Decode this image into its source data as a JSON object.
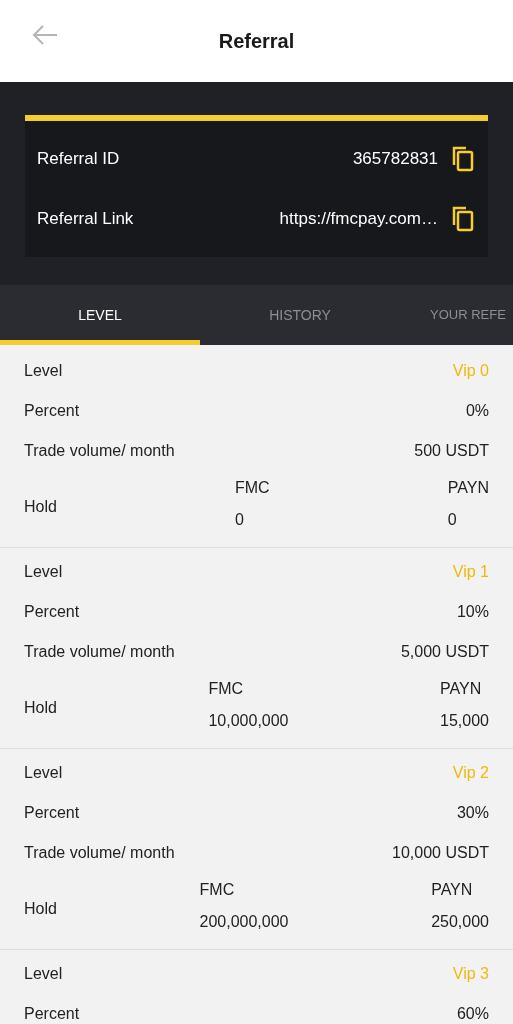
{
  "header": {
    "title": "Referral"
  },
  "referral": [
    {
      "label": "Referral ID",
      "value": "365782831"
    },
    {
      "label": "Referral Link",
      "value": "https://fmcpay.com…"
    }
  ],
  "tabs": [
    {
      "label": "LEVEL",
      "selected": true
    },
    {
      "label": "HISTORY",
      "selected": false
    },
    {
      "label": "YOUR REFE",
      "selected": false
    }
  ],
  "levels": [
    {
      "rows": [
        {
          "label": "Level",
          "value": "Vip 0",
          "kind": "vip"
        },
        {
          "label": "Percent",
          "value": "0%",
          "kind": "plain"
        },
        {
          "label": "Trade volume/ month",
          "value": "500 USDT",
          "kind": "plain"
        }
      ],
      "hold": {
        "label": "Hold",
        "assets": [
          {
            "name": "FMC",
            "amount": "0"
          },
          {
            "name": "PAYN",
            "amount": "0"
          }
        ]
      }
    },
    {
      "rows": [
        {
          "label": "Level",
          "value": "Vip 1",
          "kind": "vip"
        },
        {
          "label": "Percent",
          "value": "10%",
          "kind": "plain"
        },
        {
          "label": "Trade volume/ month",
          "value": "5,000 USDT",
          "kind": "plain"
        }
      ],
      "hold": {
        "label": "Hold",
        "assets": [
          {
            "name": "FMC",
            "amount": "10,000,000"
          },
          {
            "name": "PAYN",
            "amount": "15,000"
          }
        ]
      }
    },
    {
      "rows": [
        {
          "label": "Level",
          "value": "Vip 2",
          "kind": "vip"
        },
        {
          "label": "Percent",
          "value": "30%",
          "kind": "plain"
        },
        {
          "label": "Trade volume/ month",
          "value": "10,000 USDT",
          "kind": "plain"
        }
      ],
      "hold": {
        "label": "Hold",
        "assets": [
          {
            "name": "FMC",
            "amount": "200,000,000"
          },
          {
            "name": "PAYN",
            "amount": "250,000"
          }
        ]
      }
    },
    {
      "rows": [
        {
          "label": "Level",
          "value": "Vip 3",
          "kind": "vip"
        },
        {
          "label": "Percent",
          "value": "60%",
          "kind": "plain"
        }
      ]
    }
  ]
}
